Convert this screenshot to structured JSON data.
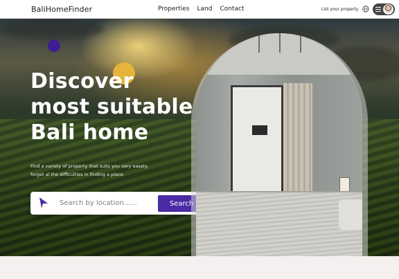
{
  "nav": {
    "logo": "BaliHomeFinder",
    "links": [
      "Properties",
      "Land",
      "Contact"
    ],
    "list_property": "List your property"
  },
  "hero": {
    "headline": [
      "Discover",
      "most suitable",
      "Bali home"
    ],
    "subtitle_lines": [
      "Find a variety of property that suits you very easely,",
      "forget al the difficulties in finding a place."
    ]
  },
  "search": {
    "placeholder": "Search by location......",
    "button_label": "Search"
  },
  "colors": {
    "accent": "#4a2aa5",
    "accent_dot": "#3c1e92",
    "yellow_dot": "#e6b43a",
    "footer_band": "#f5efef"
  },
  "icons": {
    "globe": "globe-icon",
    "menu": "hamburger-icon",
    "location": "location-arrow-icon"
  }
}
